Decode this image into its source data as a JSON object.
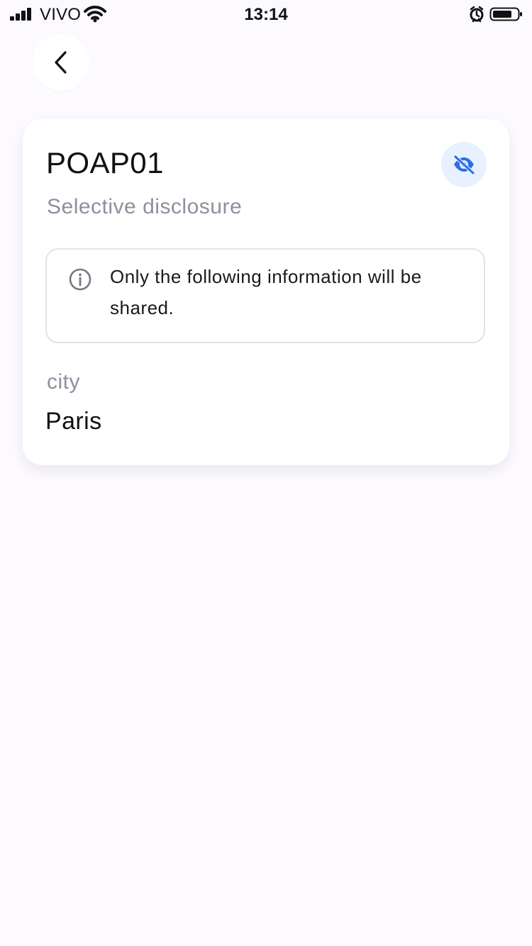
{
  "status_bar": {
    "carrier": "VIVO",
    "time": "13:14",
    "icons": [
      "signal-icon",
      "wifi-icon",
      "alarm-icon",
      "battery-icon"
    ]
  },
  "navigation": {
    "back_icon": "chevron-left-icon"
  },
  "credential": {
    "title": "POAP01",
    "subtitle": "Selective disclosure",
    "visibility_icon": "eye-slash-icon",
    "notice": "Only the following information will be shared.",
    "notice_icon": "info-icon",
    "field": {
      "label": "city",
      "value": "Paris"
    }
  },
  "colors": {
    "background": "#fcfaff",
    "card": "#ffffff",
    "accent": "#2f6de5",
    "accent_soft": "#e7f1ff",
    "muted_text": "#8f8f9d",
    "border": "#e2e2ea"
  }
}
